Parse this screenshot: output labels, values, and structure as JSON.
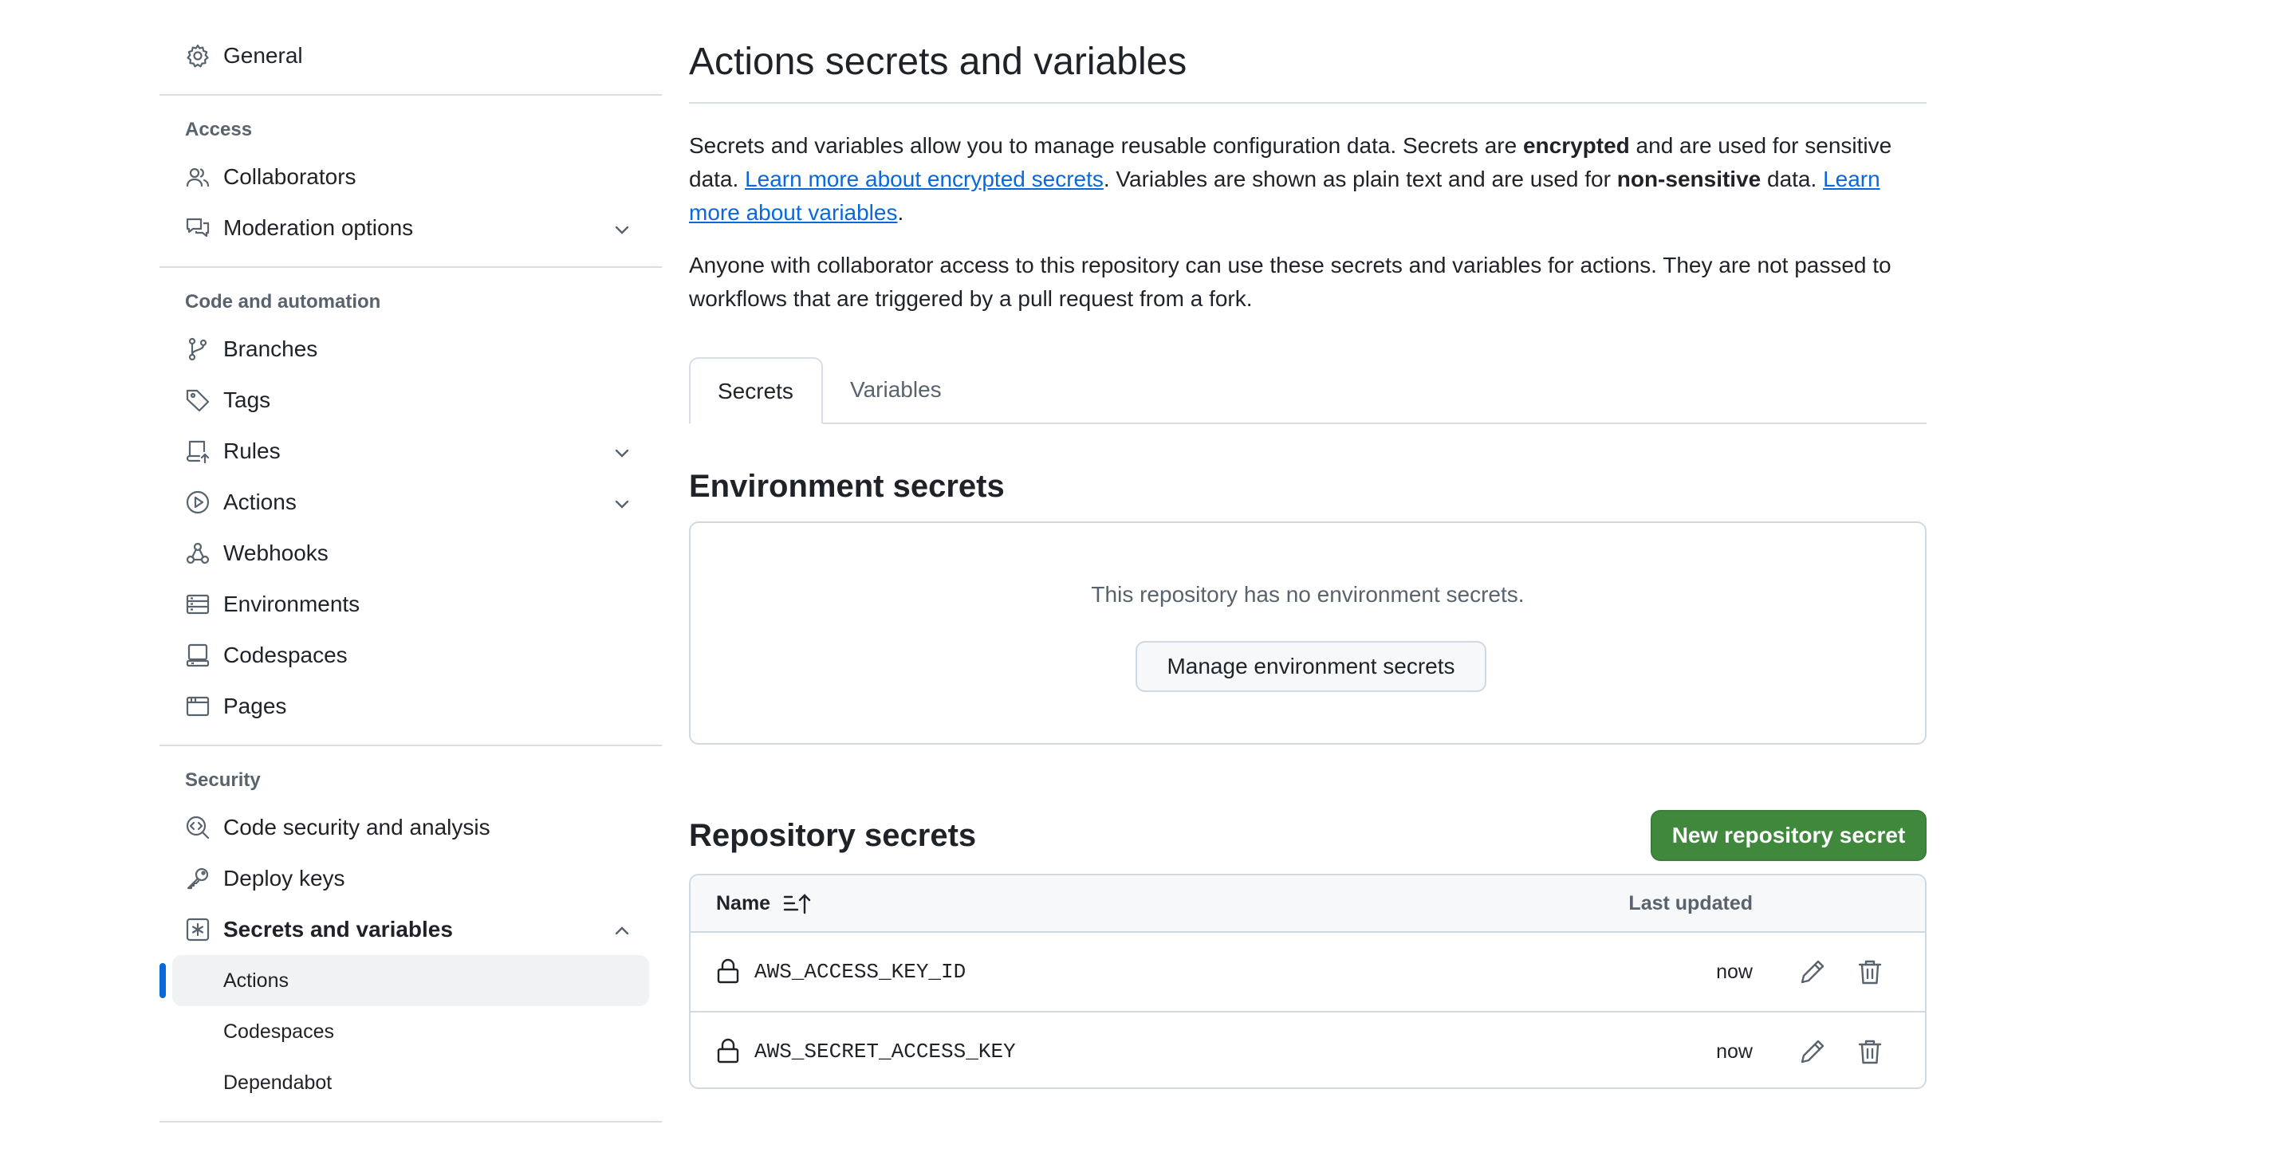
{
  "sidebar": {
    "general": "General",
    "sections": {
      "access": {
        "title": "Access",
        "items": [
          "Collaborators",
          "Moderation options"
        ]
      },
      "code": {
        "title": "Code and automation",
        "items": [
          "Branches",
          "Tags",
          "Rules",
          "Actions",
          "Webhooks",
          "Environments",
          "Codespaces",
          "Pages"
        ]
      },
      "security": {
        "title": "Security",
        "items": [
          "Code security and analysis",
          "Deploy keys",
          "Secrets and variables"
        ],
        "subitems": [
          "Actions",
          "Codespaces",
          "Dependabot"
        ],
        "active_subitem": "Actions"
      }
    }
  },
  "main": {
    "title": "Actions secrets and variables",
    "intro": {
      "t1": "Secrets and variables allow you to manage reusable configuration data. Secrets are ",
      "b1": "encrypted",
      "t2": " and are used for sensitive data. ",
      "link1": "Learn more about encrypted secrets",
      "t3": ". Variables are shown as plain text and are used for ",
      "b2": "non-sensitive",
      "t4": " data. ",
      "link2": "Learn more about variables",
      "t5": "."
    },
    "notice": "Anyone with collaborator access to this repository can use these secrets and variables for actions. They are not passed to workflows that are triggered by a pull request from a fork.",
    "tabs": [
      "Secrets",
      "Variables"
    ],
    "selected_tab": "Secrets",
    "environment": {
      "heading": "Environment secrets",
      "empty": "This repository has no environment secrets.",
      "button": "Manage environment secrets"
    },
    "repository": {
      "heading": "Repository secrets",
      "new_button": "New repository secret",
      "columns": {
        "name": "Name",
        "updated": "Last updated"
      },
      "rows": [
        {
          "name": "AWS_ACCESS_KEY_ID",
          "updated": "now"
        },
        {
          "name": "AWS_SECRET_ACCESS_KEY",
          "updated": "now"
        }
      ]
    }
  },
  "colors": {
    "accent": "#0969da",
    "primary_button": "#3f883c",
    "muted": "#59636e",
    "border": "#d1d9e0"
  }
}
